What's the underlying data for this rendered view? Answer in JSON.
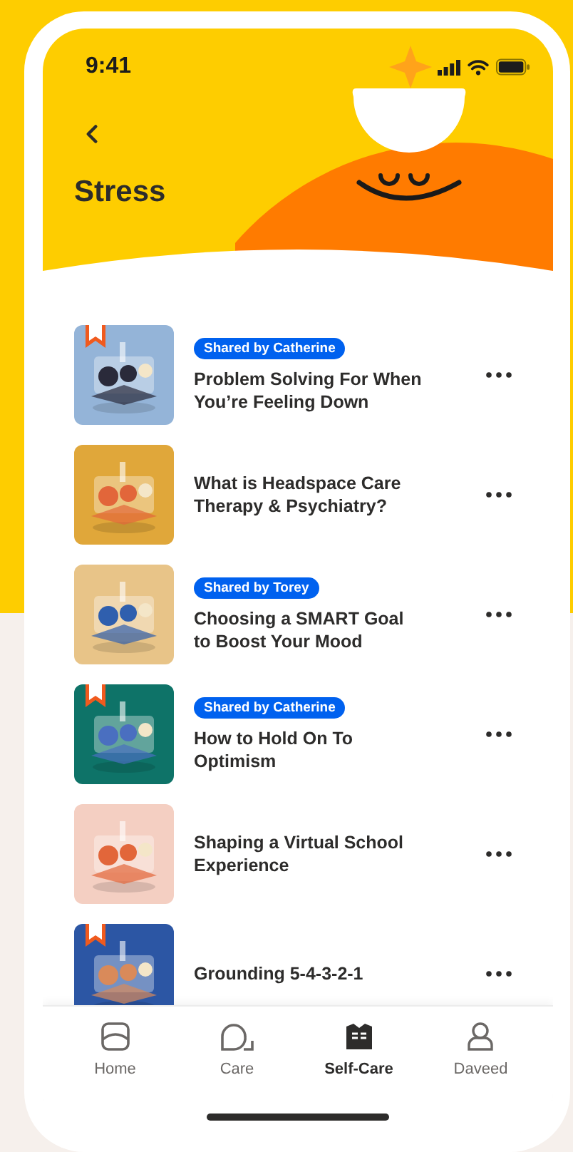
{
  "status_bar": {
    "time": "9:41"
  },
  "header": {
    "title": "Stress"
  },
  "items": [
    {
      "kind": "picture",
      "bookmarked": true,
      "shared": "Shared by Catherine",
      "title": "Problem Solving For When You’re Feeling Down"
    },
    {
      "kind": "picture",
      "bookmarked": false,
      "title": "What is Headspace Care Therapy & Psychiatry?"
    },
    {
      "kind": "picture",
      "bookmarked": false,
      "shared": "Shared by Torey",
      "title": "Choosing a SMART Goal to Boost Your Mood"
    },
    {
      "kind": "picture",
      "bookmarked": true,
      "shared": "Shared by Catherine",
      "title": "How to Hold On To Optimism"
    },
    {
      "kind": "picture",
      "bookmarked": false,
      "title": "Shaping a Virtual School Experience"
    },
    {
      "kind": "picture",
      "bookmarked": true,
      "title": "Grounding 5-4-3-2-1"
    }
  ],
  "nav": [
    {
      "kind": "home",
      "label": "Home",
      "selected": false
    },
    {
      "kind": "care",
      "label": "Care",
      "selected": false
    },
    {
      "kind": "selfcare",
      "label": "Self-Care",
      "selected": true
    },
    {
      "kind": "profile",
      "label": "Daveed",
      "selected": false
    }
  ]
}
